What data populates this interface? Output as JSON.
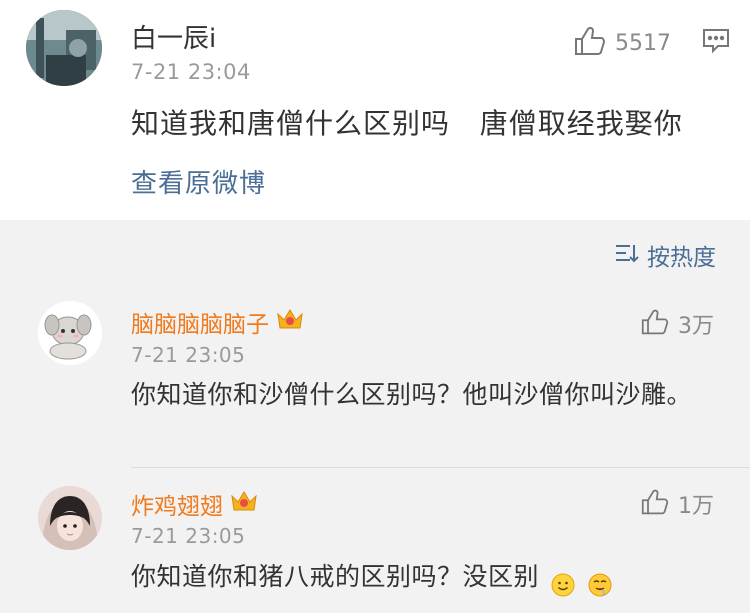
{
  "post": {
    "username": "白一辰i",
    "time": "7-21 23:04",
    "likes": "5517",
    "text": "知道我和唐僧什么区别吗   唐僧取经我娶你",
    "view_original": "查看原微博"
  },
  "sort": {
    "label": "按热度"
  },
  "comments": [
    {
      "username": "脑脑脑脑脑子",
      "time": "7-21 23:05",
      "likes": "3万",
      "text": "你知道你和沙僧什么区别吗？他叫沙僧你叫沙雕。"
    },
    {
      "username": "炸鸡翅翅",
      "time": "7-21 23:05",
      "likes": "1万",
      "text": "你知道你和猪八戒的区别吗？没区别"
    }
  ],
  "colors": {
    "username": "#f07a1e",
    "link": "#4a6e96",
    "meta": "#9a9a9a"
  }
}
